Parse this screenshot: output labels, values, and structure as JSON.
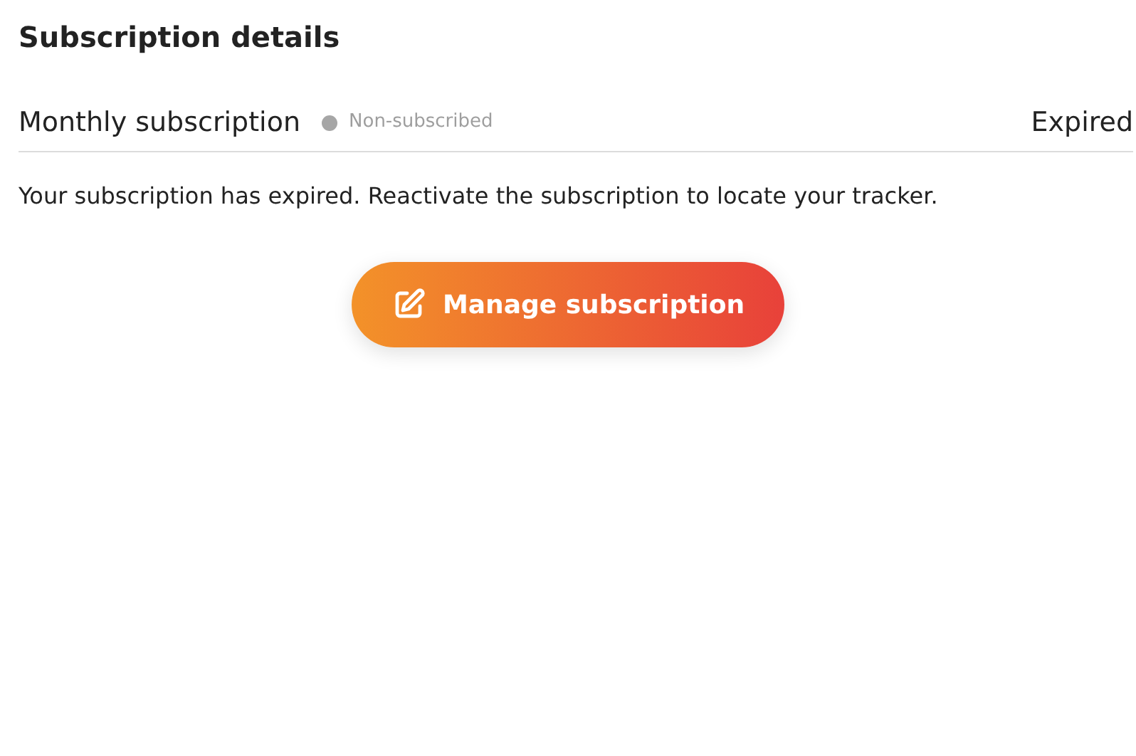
{
  "title": "Subscription details",
  "plan": {
    "name": "Monthly subscription",
    "status": {
      "label": "Non-subscribed",
      "color": "#a6a6a6"
    },
    "state": "Expired"
  },
  "message": "Your subscription has expired. Reactivate the subscription to locate your tracker.",
  "button": {
    "label": "Manage subscription"
  }
}
